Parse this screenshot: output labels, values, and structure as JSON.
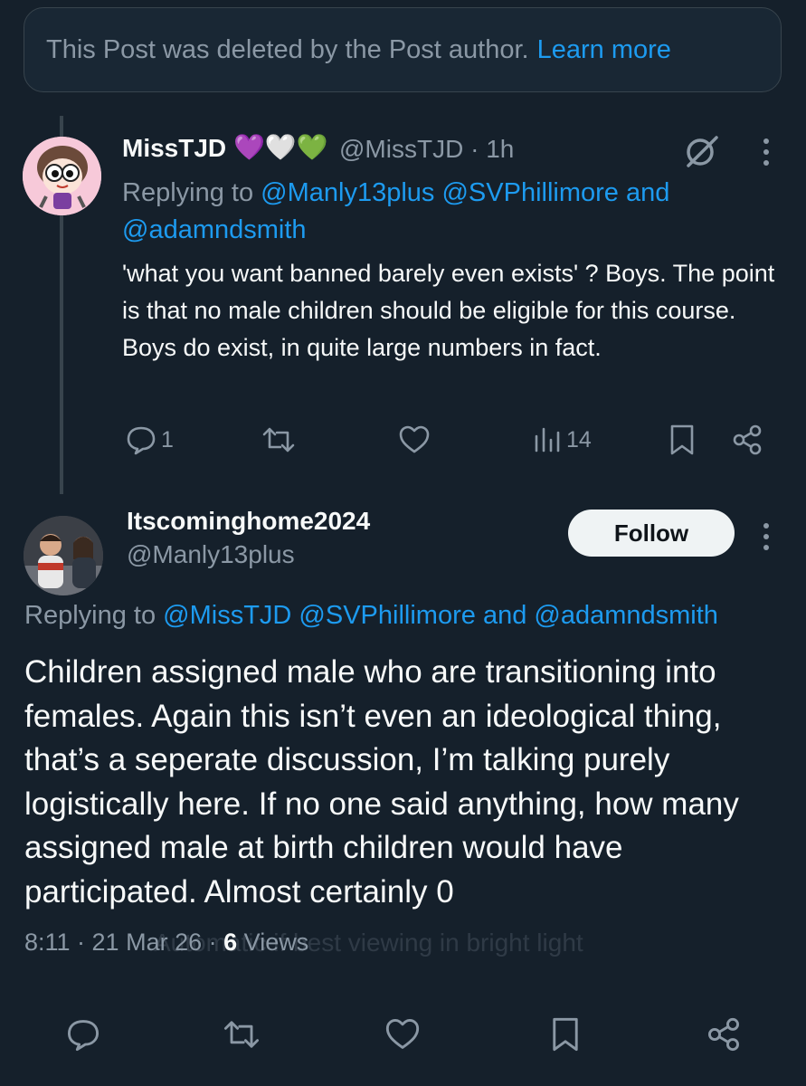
{
  "deleted_notice": {
    "text": "This Post was deleted by the Post author.",
    "link": "Learn more"
  },
  "reply": {
    "display_name": "MissTJD",
    "emoji": "💜🤍💚",
    "handle": "@MissTJD",
    "time": "1h",
    "replying_prefix": "Replying to",
    "mentions": [
      "@Manly13plus",
      "@SVPhillimore",
      "and",
      "@adamndsmith"
    ],
    "body": "'what you want banned barely even exists' ? Boys. The point is that no male children should be eligible for this course. Boys do exist, in quite large numbers in fact.",
    "reply_count": "1",
    "views": "14"
  },
  "tweet": {
    "display_name": "Itscominghome2024",
    "handle": "@Manly13plus",
    "follow_label": "Follow",
    "replying_prefix": "Replying to",
    "mentions": [
      "@MissTJD",
      "@SVPhillimore",
      "and",
      "@adamndsmith"
    ],
    "body": "Children assigned male who are transitioning into females. Again this isn’t even an ideological thing, that’s a seperate discussion, I’m talking purely logistically here. If no one said anything, how many assigned male at birth children would have participated. Almost certainly 0",
    "timestamp": "8:11 · 21 Mar 26 ·",
    "views_count": "6",
    "views_label": "Views",
    "watermark": "Automatic if best viewing in bright light"
  },
  "colors": {
    "background": "#15202b",
    "link": "#1d9bf0",
    "secondary": "#8b98a5",
    "divider": "#38444d"
  }
}
